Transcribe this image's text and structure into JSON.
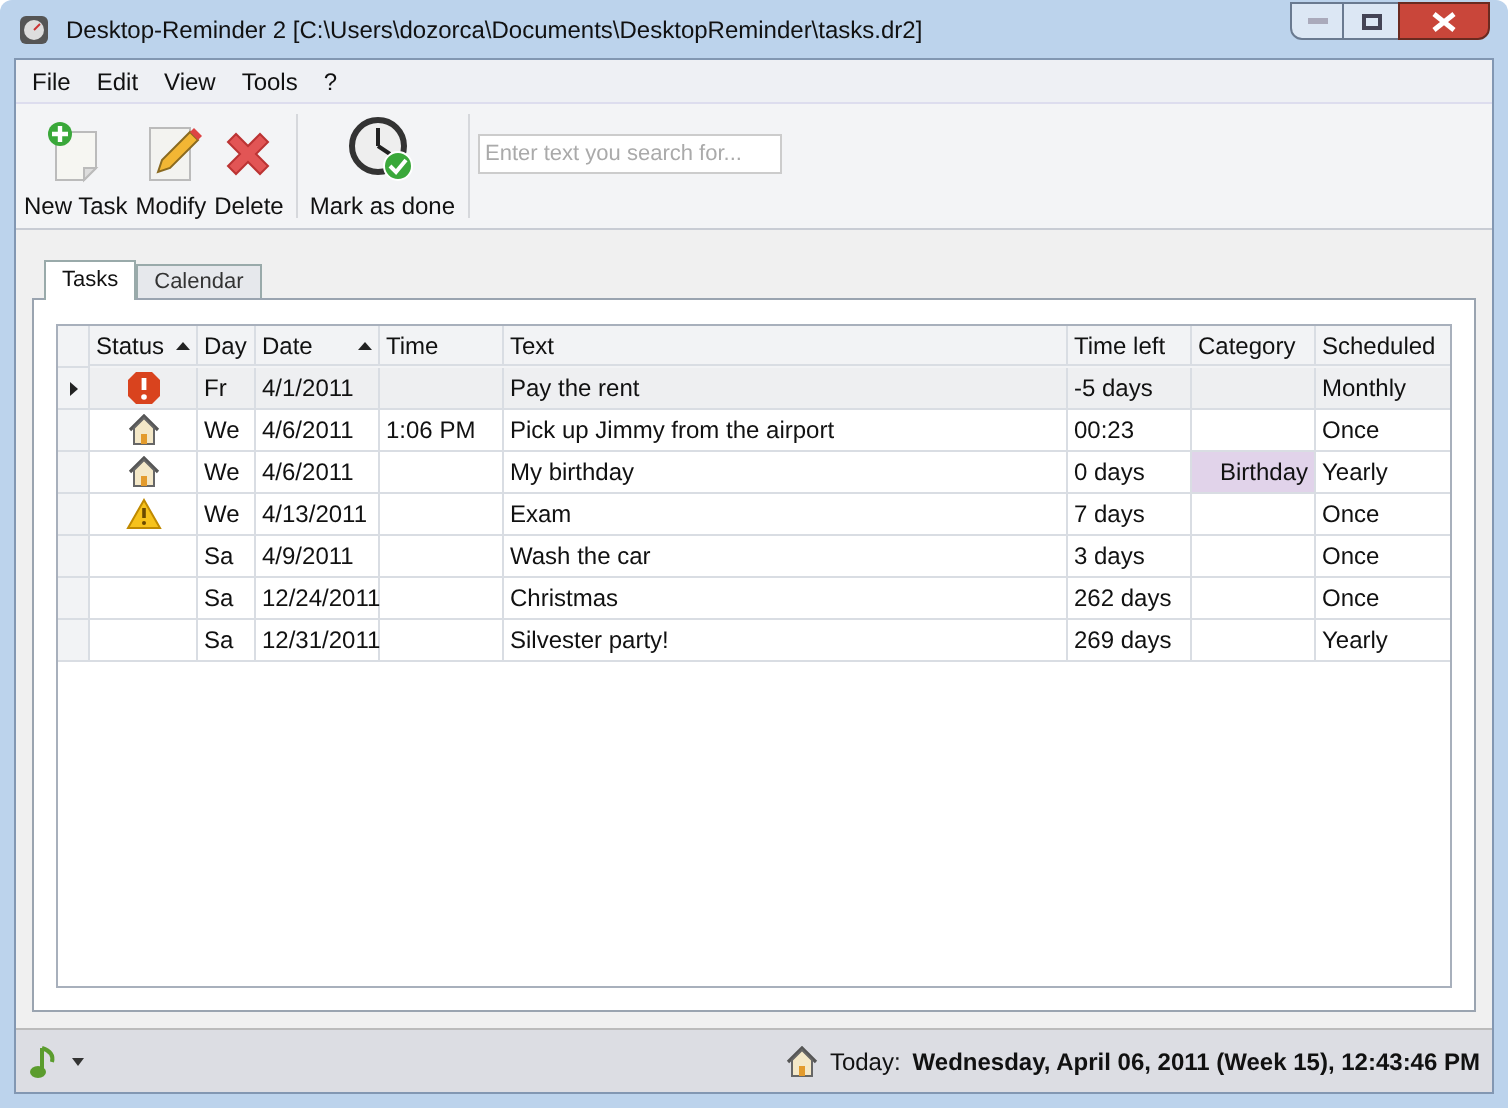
{
  "window": {
    "title": "Desktop-Reminder 2 [C:\\Users\\dozorca\\Documents\\DesktopReminder\\tasks.dr2]"
  },
  "menu": [
    "File",
    "Edit",
    "View",
    "Tools",
    "?"
  ],
  "toolbar": [
    {
      "kind": "new",
      "label": "New Task"
    },
    {
      "kind": "modify",
      "label": "Modify"
    },
    {
      "kind": "delete",
      "label": "Delete"
    },
    {
      "kind": "done",
      "label": "Mark as done"
    }
  ],
  "search": {
    "placeholder": "Enter text you search for..."
  },
  "tabs": [
    {
      "label": "Tasks",
      "selected": true
    },
    {
      "label": "Calendar",
      "selected": false
    }
  ],
  "table": {
    "columns": [
      {
        "label": "Status",
        "sorted": true
      },
      {
        "label": "Day",
        "sorted": false
      },
      {
        "label": "Date",
        "sorted": true
      },
      {
        "label": "Time",
        "sorted": false
      },
      {
        "label": "Text",
        "sorted": false
      },
      {
        "label": "Time left",
        "sorted": false
      },
      {
        "label": "Category",
        "sorted": false
      },
      {
        "label": "Scheduled",
        "sorted": false
      }
    ],
    "rows": [
      {
        "selected": true,
        "kind": "error",
        "day": "Fr",
        "date": "4/1/2011",
        "text": "Pay the rent",
        "time_left": "-5 days",
        "scheduled": "Monthly"
      },
      {
        "selected": false,
        "kind": "home",
        "day": "We",
        "date": "4/6/2011",
        "time": "1:06 PM",
        "text": "Pick up Jimmy from the airport",
        "time_left": "00:23",
        "scheduled": "Once"
      },
      {
        "selected": false,
        "kind": "home",
        "day": "We",
        "date": "4/6/2011",
        "text": "My birthday",
        "time_left": "0 days",
        "category": "Birthday",
        "color": "#e1d3ea",
        "scheduled": "Yearly"
      },
      {
        "selected": false,
        "kind": "warning",
        "day": "We",
        "date": "4/13/2011",
        "text": "Exam",
        "time_left": "7 days",
        "scheduled": "Once"
      },
      {
        "selected": false,
        "kind": "plain",
        "day": "Sa",
        "date": "4/9/2011",
        "text": "Wash the car",
        "time_left": "3 days",
        "scheduled": "Once"
      },
      {
        "selected": false,
        "kind": "plain",
        "day": "Sa",
        "date": "12/24/2011",
        "text": "Christmas",
        "time_left": "262 days",
        "scheduled": "Once"
      },
      {
        "selected": false,
        "kind": "plain",
        "day": "Sa",
        "date": "12/31/2011",
        "text": "Silvester party!",
        "time_left": "269 days",
        "scheduled": "Yearly"
      }
    ]
  },
  "status_bar": {
    "label": "Today:",
    "value": "Wednesday, April 06, 2011 (Week 15), 12:43:46 PM"
  }
}
